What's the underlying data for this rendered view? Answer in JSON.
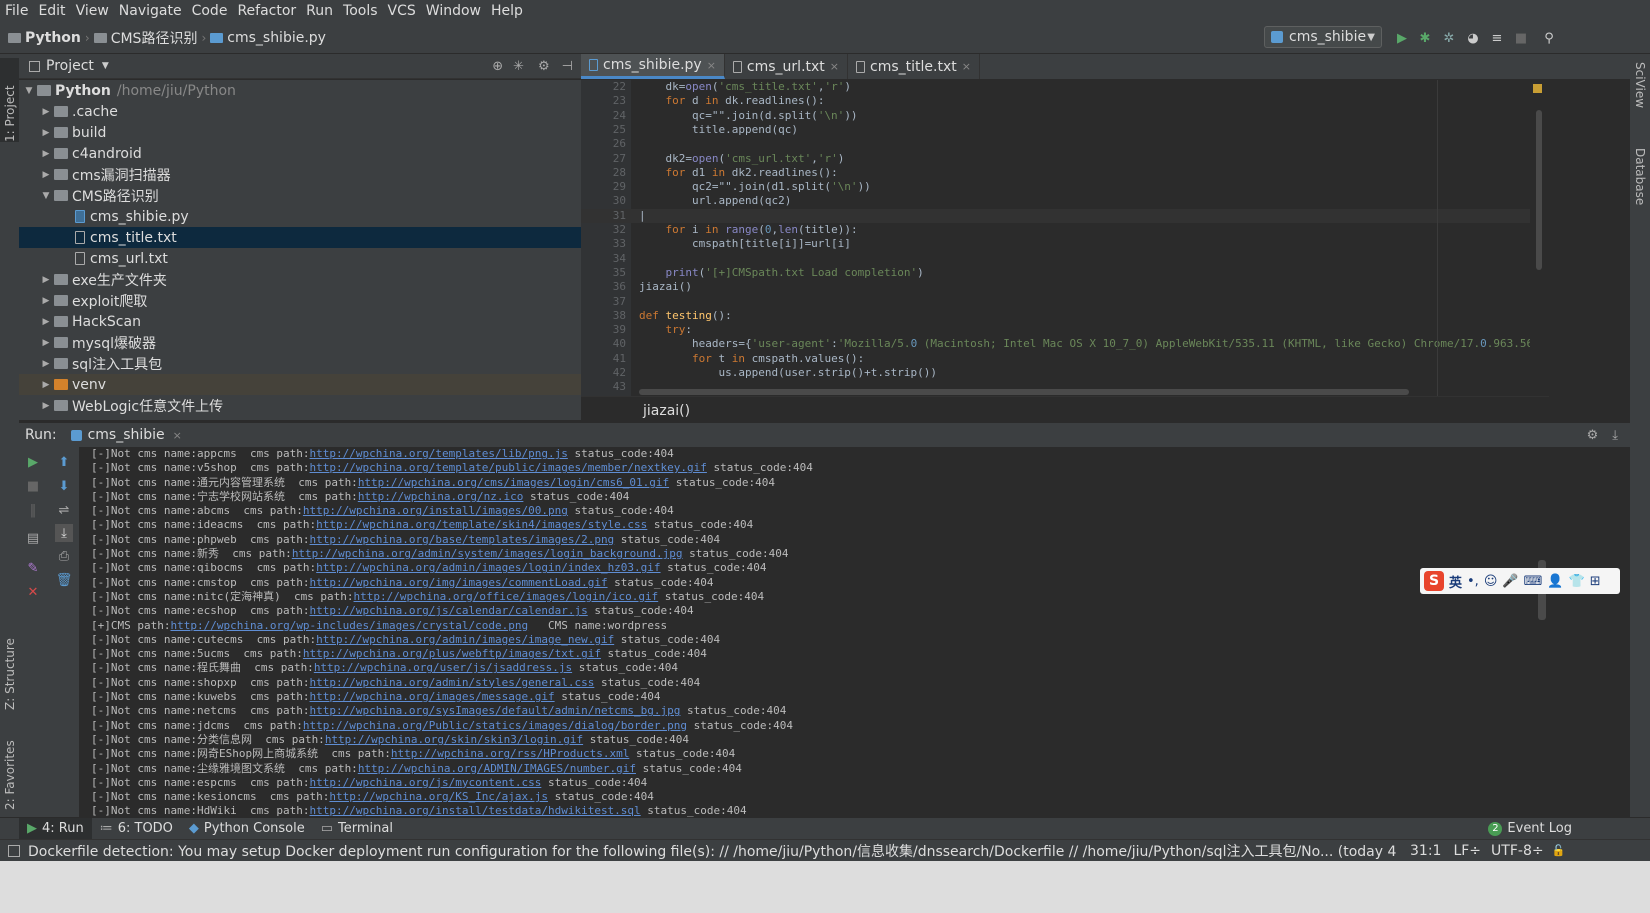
{
  "menu": [
    "File",
    "Edit",
    "View",
    "Navigate",
    "Code",
    "Refactor",
    "Run",
    "Tools",
    "VCS",
    "Window",
    "Help"
  ],
  "nav": {
    "crumbs": [
      "Python",
      "CMS路径识别",
      "cms_shibie.py"
    ],
    "run_config": "cms_shibie"
  },
  "left_strip": {
    "project": "1: Project",
    "structure": "Z: Structure",
    "favorites": "2: Favorites"
  },
  "right_strip": {
    "sciview": "SciView",
    "database": "Database"
  },
  "project": {
    "title": "Project",
    "tree": [
      {
        "label": "Python",
        "path": "/home/jiu/Python",
        "depth": 0,
        "kind": "folder",
        "open": true
      },
      {
        "label": ".cache",
        "depth": 1,
        "kind": "folder"
      },
      {
        "label": "build",
        "depth": 1,
        "kind": "folder"
      },
      {
        "label": "c4android",
        "depth": 1,
        "kind": "folder"
      },
      {
        "label": "cms漏洞扫描器",
        "depth": 1,
        "kind": "folder"
      },
      {
        "label": "CMS路径识别",
        "depth": 1,
        "kind": "folder",
        "open": true
      },
      {
        "label": "cms_shibie.py",
        "depth": 2,
        "kind": "py"
      },
      {
        "label": "cms_title.txt",
        "depth": 2,
        "kind": "txt",
        "selected": true
      },
      {
        "label": "cms_url.txt",
        "depth": 2,
        "kind": "txt"
      },
      {
        "label": "exe生产文件夹",
        "depth": 1,
        "kind": "folder"
      },
      {
        "label": "exploit爬取",
        "depth": 1,
        "kind": "folder"
      },
      {
        "label": "HackScan",
        "depth": 1,
        "kind": "folder"
      },
      {
        "label": "mysql爆破器",
        "depth": 1,
        "kind": "folder"
      },
      {
        "label": "sql注入工具包",
        "depth": 1,
        "kind": "folder"
      },
      {
        "label": "venv",
        "depth": 1,
        "kind": "venv"
      },
      {
        "label": "WebLogic任意文件上传",
        "depth": 1,
        "kind": "folder"
      }
    ]
  },
  "tabs": [
    {
      "label": "cms_shibie.py",
      "active": true
    },
    {
      "label": "cms_url.txt"
    },
    {
      "label": "cms_title.txt"
    }
  ],
  "code": [
    {
      "n": "22",
      "t": "    dk=open('cms_title.txt','r')"
    },
    {
      "n": "23",
      "t": "    for d in dk.readlines():"
    },
    {
      "n": "24",
      "t": "        qc=\"\".join(d.split('\\n'))"
    },
    {
      "n": "25",
      "t": "        title.append(qc)"
    },
    {
      "n": "26",
      "t": ""
    },
    {
      "n": "27",
      "t": "    dk2=open('cms_url.txt','r')"
    },
    {
      "n": "28",
      "t": "    for d1 in dk2.readlines():"
    },
    {
      "n": "29",
      "t": "        qc2=\"\".join(d1.split('\\n'))"
    },
    {
      "n": "30",
      "t": "        url.append(qc2)"
    },
    {
      "n": "31",
      "t": "|"
    },
    {
      "n": "32",
      "t": "    for i in range(0,len(title)):"
    },
    {
      "n": "33",
      "t": "        cmspath[title[i]]=url[i]"
    },
    {
      "n": "34",
      "t": ""
    },
    {
      "n": "35",
      "t": "    print('[+]CMSpath.txt Load completion')"
    },
    {
      "n": "36",
      "t": "jiazai()"
    },
    {
      "n": "37",
      "t": ""
    },
    {
      "n": "38",
      "t": "def testing():"
    },
    {
      "n": "39",
      "t": "    try:"
    },
    {
      "n": "40",
      "t": "        headers={'user-agent':'Mozilla/5.0 (Macintosh; Intel Mac OS X 10_7_0) AppleWebKit/535.11 (KHTML, like Gecko) Chrome/17.0.963.56"
    },
    {
      "n": "41",
      "t": "        for t in cmspath.values():"
    },
    {
      "n": "42",
      "t": "            us.append(user.strip()+t.strip())"
    },
    {
      "n": "43",
      "t": ""
    }
  ],
  "editor_crumb": "jiazai()",
  "run": {
    "label": "Run:",
    "tab": "cms_shibie",
    "lines": [
      {
        "pre": "[-]Not cms name:appcms  cms path:",
        "link": "http://wpchina.org/templates/lib/png.js",
        "post": " status_code:404"
      },
      {
        "pre": "[-]Not cms name:v5shop  cms path:",
        "link": "http://wpchina.org/template/public/images/member/nextkey.gif",
        "post": " status_code:404"
      },
      {
        "pre": "[-]Not cms name:通元内容管理系统  cms path:",
        "link": "http://wpchina.org/cms/images/login/cms6_01.gif",
        "post": " status_code:404"
      },
      {
        "pre": "[-]Not cms name:宁志学校网站系统  cms path:",
        "link": "http://wpchina.org/nz.ico",
        "post": " status_code:404"
      },
      {
        "pre": "[-]Not cms name:abcms  cms path:",
        "link": "http://wpchina.org/install/images/00.png",
        "post": " status_code:404"
      },
      {
        "pre": "[-]Not cms name:ideacms  cms path:",
        "link": "http://wpchina.org/template/skin4/images/style.css",
        "post": " status_code:404"
      },
      {
        "pre": "[-]Not cms name:phpweb  cms path:",
        "link": "http://wpchina.org/base/templates/images/2.png",
        "post": " status_code:404"
      },
      {
        "pre": "[-]Not cms name:新秀  cms path:",
        "link": "http://wpchina.org/admin/system/images/login_background.jpg",
        "post": " status_code:404"
      },
      {
        "pre": "[-]Not cms name:qibocms  cms path:",
        "link": "http://wpchina.org/admin/images/login/index_hz03.gif",
        "post": " status_code:404"
      },
      {
        "pre": "[-]Not cms name:cmstop  cms path:",
        "link": "http://wpchina.org/img/images/commentLoad.gif",
        "post": " status_code:404"
      },
      {
        "pre": "[-]Not cms name:nitc(定海神真)  cms path:",
        "link": "http://wpchina.org/office/images/login/ico.gif",
        "post": " status_code:404"
      },
      {
        "pre": "[-]Not cms name:ecshop  cms path:",
        "link": "http://wpchina.org/js/calendar/calendar.js",
        "post": " status_code:404"
      },
      {
        "pre": "[+]CMS path:",
        "link": "http://wpchina.org/wp-includes/images/crystal/code.png",
        "post": "   CMS name:wordpress"
      },
      {
        "pre": "[-]Not cms name:cutecms  cms path:",
        "link": "http://wpchina.org/admin/images/image_new.gif",
        "post": " status_code:404"
      },
      {
        "pre": "[-]Not cms name:5ucms  cms path:",
        "link": "http://wpchina.org/plus/webftp/images/txt.gif",
        "post": " status_code:404"
      },
      {
        "pre": "[-]Not cms name:程氏舞曲  cms path:",
        "link": "http://wpchina.org/user/js/jsaddress.js",
        "post": " status_code:404"
      },
      {
        "pre": "[-]Not cms name:shopxp  cms path:",
        "link": "http://wpchina.org/admin/styles/general.css",
        "post": " status_code:404"
      },
      {
        "pre": "[-]Not cms name:kuwebs  cms path:",
        "link": "http://wpchina.org/images/message.gif",
        "post": " status_code:404"
      },
      {
        "pre": "[-]Not cms name:netcms  cms path:",
        "link": "http://wpchina.org/sysImages/default/admin/netcms_bg.jpg",
        "post": " status_code:404"
      },
      {
        "pre": "[-]Not cms name:jdcms  cms path:",
        "link": "http://wpchina.org/Public/statics/images/dialog/border.png",
        "post": " status_code:404"
      },
      {
        "pre": "[-]Not cms name:分类信息网  cms path:",
        "link": "http://wpchina.org/skin/skin3/login.gif",
        "post": " status_code:404"
      },
      {
        "pre": "[-]Not cms name:网奇EShop网上商城系统  cms path:",
        "link": "http://wpchina.org/rss/HProducts.xml",
        "post": " status_code:404"
      },
      {
        "pre": "[-]Not cms name:尘缘雅境图文系统  cms path:",
        "link": "http://wpchina.org/ADMIN/IMAGES/number.gif",
        "post": " status_code:404"
      },
      {
        "pre": "[-]Not cms name:espcms  cms path:",
        "link": "http://wpchina.org/js/mycontent.css",
        "post": " status_code:404"
      },
      {
        "pre": "[-]Not cms name:kesioncms  cms path:",
        "link": "http://wpchina.org/KS_Inc/ajax.js",
        "post": " status_code:404"
      },
      {
        "pre": "[-]Not cms name:HdWiki  cms path:",
        "link": "http://wpchina.org/install/testdata/hdwikitest.sql",
        "post": " status_code:404"
      }
    ]
  },
  "bottom_tabs": [
    "4: Run",
    "6: TODO",
    "Python Console",
    "Terminal"
  ],
  "event_log": "Event Log",
  "event_count": "2",
  "status": {
    "message": "Dockerfile detection: You may setup Docker deployment run configuration for the following file(s): // /home/jiu/Python/信息收集/dnssearch/Dockerfile // /home/jiu/Python/sql注入工具包/No... (today 4:55 AM)",
    "position": "31:1",
    "line_sep": "LF÷",
    "encoding": "UTF-8÷"
  },
  "ime": {
    "lang": "英"
  },
  "colors": {
    "link": "#5f8dd3",
    "keyword": "#cc7832",
    "string": "#6a8759",
    "selection": "#0d293e"
  }
}
